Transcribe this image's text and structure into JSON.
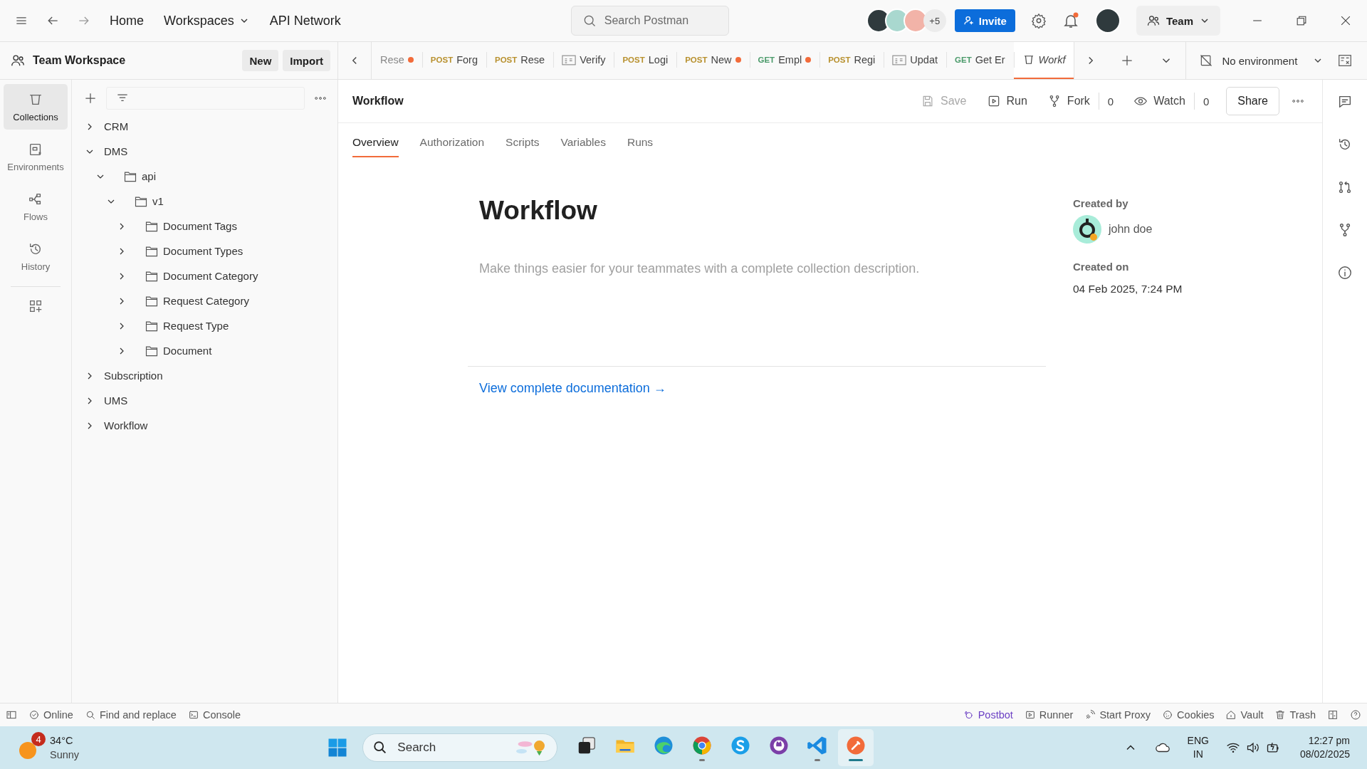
{
  "topbar": {
    "nav": [
      {
        "label": "Home",
        "dropdown": false
      },
      {
        "label": "Workspaces",
        "dropdown": true
      },
      {
        "label": "API Network",
        "dropdown": false
      }
    ],
    "search": {
      "placeholder": "Search Postman"
    },
    "avatars_more": "+5",
    "invite": "Invite",
    "notification_unread": true,
    "team": "Team"
  },
  "workspace": {
    "title": "Team Workspace",
    "buttons": [
      "New",
      "Import"
    ]
  },
  "rail": [
    {
      "label": "Collections",
      "selected": true
    },
    {
      "label": "Environments",
      "selected": false
    },
    {
      "label": "Flows",
      "selected": false
    },
    {
      "label": "History",
      "selected": false
    }
  ],
  "tree": [
    {
      "label": "CRM",
      "kind": "collection",
      "expanded": false
    },
    {
      "label": "DMS",
      "kind": "collection",
      "expanded": true,
      "children": [
        {
          "label": "api",
          "kind": "folder",
          "expanded": true,
          "children": [
            {
              "label": "v1",
              "kind": "folder",
              "expanded": true,
              "children": [
                {
                  "label": "Document Tags",
                  "kind": "folder",
                  "expanded": false
                },
                {
                  "label": "Document Types",
                  "kind": "folder",
                  "expanded": false
                },
                {
                  "label": "Document Category",
                  "kind": "folder",
                  "expanded": false
                },
                {
                  "label": "Request Category",
                  "kind": "folder",
                  "expanded": false
                },
                {
                  "label": "Request Type",
                  "kind": "folder",
                  "expanded": false
                },
                {
                  "label": "Document",
                  "kind": "folder",
                  "expanded": false
                }
              ]
            }
          ]
        }
      ]
    },
    {
      "label": "Subscription",
      "kind": "collection",
      "expanded": false
    },
    {
      "label": "UMS",
      "kind": "collection",
      "expanded": false
    },
    {
      "label": "Workflow",
      "kind": "collection",
      "expanded": false
    }
  ],
  "tabs": [
    {
      "kind": "request",
      "label": "Rese",
      "unsaved": true,
      "selected": false,
      "preview": false
    },
    {
      "kind": "request",
      "method": "POST",
      "color": "#b8912f",
      "label": "Forg",
      "unsaved": false,
      "selected": false,
      "preview": false
    },
    {
      "kind": "request",
      "method": "POST",
      "color": "#b8912f",
      "label": "Rese",
      "unsaved": false,
      "selected": false,
      "preview": false
    },
    {
      "kind": "example",
      "label": "Verify",
      "unsaved": false,
      "selected": false,
      "preview": false
    },
    {
      "kind": "request",
      "method": "POST",
      "color": "#b8912f",
      "label": "Logi",
      "unsaved": false,
      "selected": false,
      "preview": false
    },
    {
      "kind": "request",
      "method": "POST",
      "color": "#b8912f",
      "label": "New",
      "unsaved": true,
      "selected": false,
      "preview": false
    },
    {
      "kind": "request",
      "method": "GET",
      "color": "#4a9a6a",
      "label": "Empl",
      "unsaved": true,
      "selected": false,
      "preview": false
    },
    {
      "kind": "request",
      "method": "POST",
      "color": "#b8912f",
      "label": "Regi",
      "unsaved": false,
      "selected": false,
      "preview": false
    },
    {
      "kind": "example",
      "label": "Updat",
      "unsaved": false,
      "selected": false,
      "preview": false
    },
    {
      "kind": "request",
      "method": "GET",
      "color": "#4a9a6a",
      "label": "Get Er",
      "unsaved": false,
      "selected": false,
      "preview": false
    },
    {
      "kind": "collection",
      "label": "Workf",
      "unsaved": false,
      "selected": true,
      "preview": true
    }
  ],
  "environment": "No environment",
  "collection": {
    "title": "Workflow",
    "actions": [
      {
        "kind": "save",
        "label": "Save",
        "disabled": true
      },
      {
        "kind": "run",
        "label": "Run",
        "disabled": false
      },
      {
        "kind": "fork",
        "label": "Fork",
        "count": "0",
        "disabled": false
      },
      {
        "kind": "watch",
        "label": "Watch",
        "count": "0",
        "disabled": false
      }
    ],
    "share": "Share"
  },
  "subtabs": [
    {
      "label": "Overview",
      "selected": true
    },
    {
      "label": "Authorization",
      "selected": false
    },
    {
      "label": "Scripts",
      "selected": false
    },
    {
      "label": "Variables",
      "selected": false
    },
    {
      "label": "Runs",
      "selected": false
    }
  ],
  "overview": {
    "title": "Workflow",
    "description_placeholder": "Make things easier for your teammates with a complete collection description.",
    "created_by_label": "Created by",
    "author": "john doe",
    "created_on_label": "Created on",
    "created_on": "04 Feb 2025, 7:24 PM",
    "docs_link": "View complete documentation →"
  },
  "statusbar": {
    "left": [
      "Online",
      "Find and replace",
      "Console"
    ],
    "right": [
      {
        "label": "Postbot",
        "accent": true
      },
      {
        "label": "Runner",
        "accent": false
      },
      {
        "label": "Start Proxy",
        "accent": false
      },
      {
        "label": "Cookies",
        "accent": false
      },
      {
        "label": "Vault",
        "accent": false
      },
      {
        "label": "Trash",
        "accent": false
      }
    ]
  },
  "taskbar": {
    "weather": {
      "badge": "4",
      "temp": "34°C",
      "condition": "Sunny"
    },
    "search": {
      "placeholder": "Search"
    },
    "apps": [
      {
        "running": false,
        "selected": false
      },
      {
        "running": false,
        "selected": false
      },
      {
        "running": false,
        "selected": false
      },
      {
        "running": true,
        "selected": false
      },
      {
        "running": false,
        "selected": false
      },
      {
        "running": false,
        "selected": false
      },
      {
        "running": true,
        "selected": false
      },
      {
        "running": true,
        "selected": true
      }
    ],
    "tray": {
      "lang": "ENG",
      "region": "IN",
      "time": "12:27 pm",
      "date": "08/02/2025"
    }
  }
}
